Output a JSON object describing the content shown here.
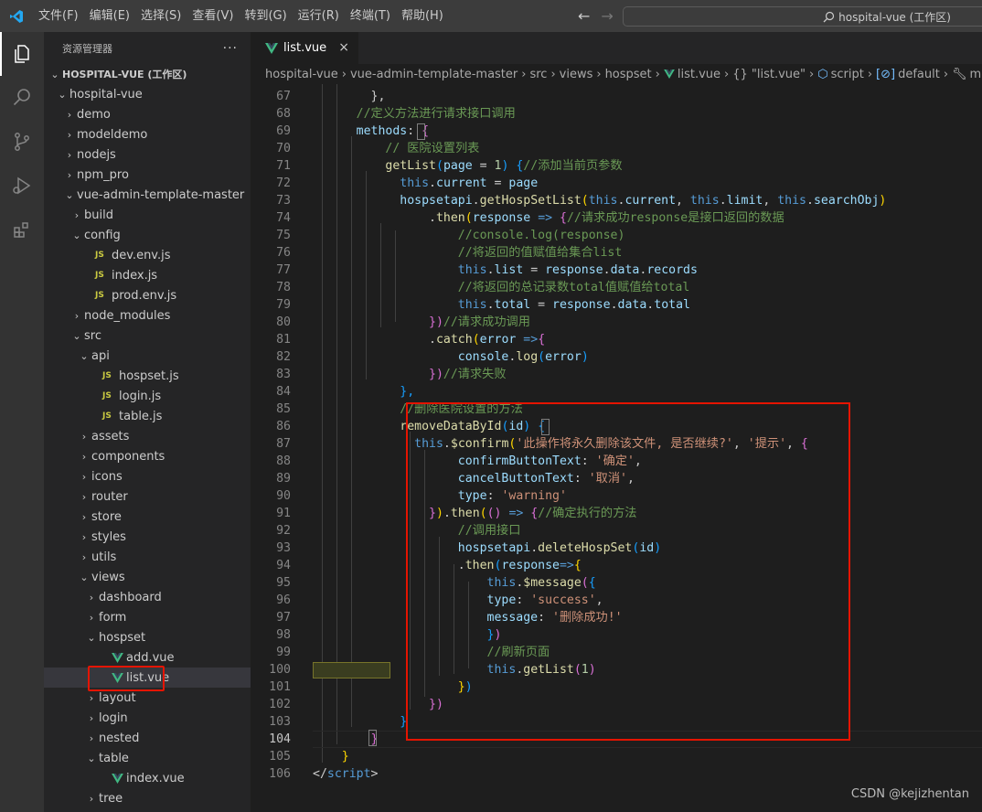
{
  "titlebar": {
    "menu": [
      "文件(F)",
      "编辑(E)",
      "选择(S)",
      "查看(V)",
      "转到(G)",
      "运行(R)",
      "终端(T)",
      "帮助(H)"
    ],
    "search_text": "hospital-vue (工作区)"
  },
  "sidebar": {
    "title": "资源管理器",
    "more": "···",
    "items": [
      {
        "label": "HOSPITAL-VUE (工作区)",
        "depth": 0,
        "type": "root",
        "twisty": "⌄"
      },
      {
        "label": "hospital-vue",
        "depth": 1,
        "type": "folder",
        "twisty": "⌄"
      },
      {
        "label": "demo",
        "depth": 2,
        "type": "folder",
        "twisty": "›"
      },
      {
        "label": "modeldemo",
        "depth": 2,
        "type": "folder",
        "twisty": "›"
      },
      {
        "label": "nodejs",
        "depth": 2,
        "type": "folder",
        "twisty": "›"
      },
      {
        "label": "npm_pro",
        "depth": 2,
        "type": "folder",
        "twisty": "›"
      },
      {
        "label": "vue-admin-template-master",
        "depth": 2,
        "type": "folder",
        "twisty": "⌄"
      },
      {
        "label": "build",
        "depth": 3,
        "type": "folder",
        "twisty": "›"
      },
      {
        "label": "config",
        "depth": 3,
        "type": "folder",
        "twisty": "⌄"
      },
      {
        "label": "dev.env.js",
        "depth": 4,
        "type": "js"
      },
      {
        "label": "index.js",
        "depth": 4,
        "type": "js"
      },
      {
        "label": "prod.env.js",
        "depth": 4,
        "type": "js"
      },
      {
        "label": "node_modules",
        "depth": 3,
        "type": "folder",
        "twisty": "›"
      },
      {
        "label": "src",
        "depth": 3,
        "type": "folder",
        "twisty": "⌄"
      },
      {
        "label": "api",
        "depth": 4,
        "type": "folder",
        "twisty": "⌄"
      },
      {
        "label": "hospset.js",
        "depth": 5,
        "type": "js"
      },
      {
        "label": "login.js",
        "depth": 5,
        "type": "js"
      },
      {
        "label": "table.js",
        "depth": 5,
        "type": "js"
      },
      {
        "label": "assets",
        "depth": 4,
        "type": "folder",
        "twisty": "›"
      },
      {
        "label": "components",
        "depth": 4,
        "type": "folder",
        "twisty": "›"
      },
      {
        "label": "icons",
        "depth": 4,
        "type": "folder",
        "twisty": "›"
      },
      {
        "label": "router",
        "depth": 4,
        "type": "folder",
        "twisty": "›"
      },
      {
        "label": "store",
        "depth": 4,
        "type": "folder",
        "twisty": "›"
      },
      {
        "label": "styles",
        "depth": 4,
        "type": "folder",
        "twisty": "›"
      },
      {
        "label": "utils",
        "depth": 4,
        "type": "folder",
        "twisty": "›"
      },
      {
        "label": "views",
        "depth": 4,
        "type": "folder",
        "twisty": "⌄"
      },
      {
        "label": "dashboard",
        "depth": 5,
        "type": "folder",
        "twisty": "›"
      },
      {
        "label": "form",
        "depth": 5,
        "type": "folder",
        "twisty": "›"
      },
      {
        "label": "hospset",
        "depth": 5,
        "type": "folder",
        "twisty": "⌄"
      },
      {
        "label": "add.vue",
        "depth": 6,
        "type": "vue"
      },
      {
        "label": "list.vue",
        "depth": 6,
        "type": "vue",
        "selected": true
      },
      {
        "label": "layout",
        "depth": 5,
        "type": "folder",
        "twisty": "›"
      },
      {
        "label": "login",
        "depth": 5,
        "type": "folder",
        "twisty": "›"
      },
      {
        "label": "nested",
        "depth": 5,
        "type": "folder",
        "twisty": "›"
      },
      {
        "label": "table",
        "depth": 5,
        "type": "folder",
        "twisty": "⌄"
      },
      {
        "label": "index.vue",
        "depth": 6,
        "type": "vue"
      },
      {
        "label": "tree",
        "depth": 5,
        "type": "folder",
        "twisty": "›"
      }
    ]
  },
  "tab": {
    "label": "list.vue",
    "close": "×"
  },
  "breadcrumbs": [
    "hospital-vue",
    "vue-admin-template-master",
    "src",
    "views",
    "hospset",
    "list.vue",
    "{} \"list.vue\"",
    "script",
    "default",
    "methods"
  ],
  "editor": {
    "lines": [
      {
        "n": "67",
        "html": "<span class=\"p\">        },</span>"
      },
      {
        "n": "68",
        "html": "<span class=\"c\">      //定义方法进行请求接口调用</span>"
      },
      {
        "n": "69",
        "html": "<span class=\"v\">      methods</span><span class=\"p\">: </span><span class=\"b2\">{</span>"
      },
      {
        "n": "70",
        "html": "<span class=\"c\">          // 医院设置列表</span>"
      },
      {
        "n": "71",
        "html": "<span class=\"f\">          getList</span><span class=\"b3\">(</span><span class=\"v\">page</span><span class=\"p\"> = </span><span class=\"n\">1</span><span class=\"b3\">)</span><span class=\"p\"> </span><span class=\"b3\">{</span><span class=\"c\">//添加当前页参数</span>"
      },
      {
        "n": "72",
        "html": "<span class=\"k\">            this</span><span class=\"p\">.</span><span class=\"v\">current</span><span class=\"p\"> = </span><span class=\"v\">page</span>"
      },
      {
        "n": "73",
        "html": "<span class=\"v\">            hospsetapi</span><span class=\"p\">.</span><span class=\"f\">getHospSetList</span><span class=\"b1\">(</span><span class=\"k\">this</span><span class=\"p\">.</span><span class=\"v\">current</span><span class=\"p\">, </span><span class=\"k\">this</span><span class=\"p\">.</span><span class=\"v\">limit</span><span class=\"p\">, </span><span class=\"k\">this</span><span class=\"p\">.</span><span class=\"v\">searchObj</span><span class=\"b1\">)</span>"
      },
      {
        "n": "74",
        "html": "<span class=\"p\">                .</span><span class=\"f\">then</span><span class=\"b1\">(</span><span class=\"v\">response</span><span class=\"p\"> </span><span class=\"k\">=&gt;</span><span class=\"p\"> </span><span class=\"b2\">{</span><span class=\"c\">//请求成功response是接口返回的数据</span>"
      },
      {
        "n": "75",
        "html": "<span class=\"c\">                    //console.log(response)</span>"
      },
      {
        "n": "76",
        "html": "<span class=\"c\">                    //将返回的值赋值给集合list</span>"
      },
      {
        "n": "77",
        "html": "<span class=\"k\">                    this</span><span class=\"p\">.</span><span class=\"v\">list</span><span class=\"p\"> = </span><span class=\"v\">response</span><span class=\"p\">.</span><span class=\"v\">data</span><span class=\"p\">.</span><span class=\"v\">records</span>"
      },
      {
        "n": "78",
        "html": "<span class=\"c\">                    //将返回的总记录数total值赋值给total</span>"
      },
      {
        "n": "79",
        "html": "<span class=\"k\">                    this</span><span class=\"p\">.</span><span class=\"v\">total</span><span class=\"p\"> = </span><span class=\"v\">response</span><span class=\"p\">.</span><span class=\"v\">data</span><span class=\"p\">.</span><span class=\"v\">total</span>"
      },
      {
        "n": "80",
        "html": "<span class=\"b2\">                })</span><span class=\"c\">//请求成功调用</span>"
      },
      {
        "n": "81",
        "html": "<span class=\"p\">                .</span><span class=\"f\">catch</span><span class=\"b1\">(</span><span class=\"v\">error</span><span class=\"p\"> </span><span class=\"k\">=&gt;</span><span class=\"b2\">{</span>"
      },
      {
        "n": "82",
        "html": "<span class=\"v\">                    console</span><span class=\"p\">.</span><span class=\"f\">log</span><span class=\"b3\">(</span><span class=\"v\">error</span><span class=\"b3\">)</span>"
      },
      {
        "n": "83",
        "html": "<span class=\"b2\">                })</span><span class=\"c\">//请求失败</span>"
      },
      {
        "n": "84",
        "html": "<span class=\"b3\">            },</span>"
      },
      {
        "n": "85",
        "html": "<span class=\"c\">            //删除医院设置的方法</span>"
      },
      {
        "n": "86",
        "html": "<span class=\"f\">            removeDataById</span><span class=\"b3\">(</span><span class=\"v\">id</span><span class=\"b3\">)</span><span class=\"p\"> </span><span class=\"b3\">{</span>"
      },
      {
        "n": "87",
        "html": "<span class=\"k\">              this</span><span class=\"p\">.</span><span class=\"f\">$confirm</span><span class=\"b1\">(</span><span class=\"s\">'此操作将永久删除该文件, 是否继续?'</span><span class=\"p\">, </span><span class=\"s\">'提示'</span><span class=\"p\">, </span><span class=\"b2\">{</span>"
      },
      {
        "n": "88",
        "html": "<span class=\"v\">                    confirmButtonText</span><span class=\"p\">: </span><span class=\"s\">'确定'</span><span class=\"p\">,</span>"
      },
      {
        "n": "89",
        "html": "<span class=\"v\">                    cancelButtonText</span><span class=\"p\">: </span><span class=\"s\">'取消'</span><span class=\"p\">,</span>"
      },
      {
        "n": "90",
        "html": "<span class=\"v\">                    type</span><span class=\"p\">: </span><span class=\"s\">'warning'</span>"
      },
      {
        "n": "91",
        "html": "<span class=\"b2\">                }</span><span class=\"b1\">)</span><span class=\"p\">.</span><span class=\"f\">then</span><span class=\"b1\">(</span><span class=\"b2\">()</span><span class=\"p\"> </span><span class=\"k\">=&gt;</span><span class=\"p\"> </span><span class=\"b2\">{</span><span class=\"c\">//确定执行的方法</span>"
      },
      {
        "n": "92",
        "html": "<span class=\"c\">                    //调用接口</span>"
      },
      {
        "n": "93",
        "html": "<span class=\"v\">                    hospsetapi</span><span class=\"p\">.</span><span class=\"f\">deleteHospSet</span><span class=\"b3\">(</span><span class=\"v\">id</span><span class=\"b3\">)</span>"
      },
      {
        "n": "94",
        "html": "<span class=\"p\">                    .</span><span class=\"f\">then</span><span class=\"b3\">(</span><span class=\"v\">response</span><span class=\"k\">=&gt;</span><span class=\"b1\">{</span>"
      },
      {
        "n": "95",
        "html": "<span class=\"k\">                        this</span><span class=\"p\">.</span><span class=\"f\">$message</span><span class=\"b2\">(</span><span class=\"b3\">{</span>"
      },
      {
        "n": "96",
        "html": "<span class=\"v\">                        type</span><span class=\"p\">: </span><span class=\"s\">'success'</span><span class=\"p\">,</span>"
      },
      {
        "n": "97",
        "html": "<span class=\"v\">                        message</span><span class=\"p\">: </span><span class=\"s\">'删除成功!'</span>"
      },
      {
        "n": "98",
        "html": "<span class=\"b3\">                        }</span><span class=\"b2\">)</span>"
      },
      {
        "n": "99",
        "html": "<span class=\"c\">                        //刷新页面</span>"
      },
      {
        "n": "100",
        "html": "<span class=\"k\">                        this</span><span class=\"p\">.</span><span class=\"f\">getList</span><span class=\"b2\">(</span><span class=\"n\">1</span><span class=\"b2\">)</span>"
      },
      {
        "n": "101",
        "html": "<span class=\"b1\">                    }</span><span class=\"b3\">)</span>"
      },
      {
        "n": "102",
        "html": "<span class=\"b2\">                })</span>"
      },
      {
        "n": "103",
        "html": "<span class=\"b3\">            }</span>"
      },
      {
        "n": "104",
        "html": "<span class=\"p\">        </span><span class=\"b2\">}</span>"
      },
      {
        "n": "105",
        "html": "<span class=\"b1\">    }</span>"
      },
      {
        "n": "106",
        "html": "<span class=\"p\">&lt;/</span><span class=\"k\">script</span><span class=\"p\">&gt;</span>"
      }
    ]
  },
  "watermark": "CSDN @kejizhentan"
}
